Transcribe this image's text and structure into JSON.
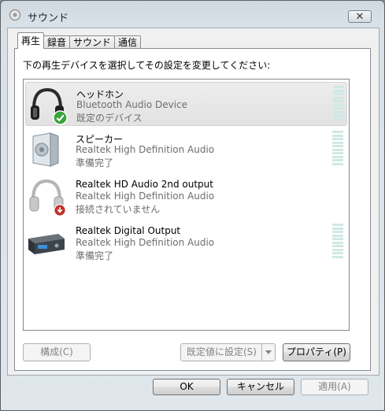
{
  "window": {
    "title": "サウンド",
    "close_symbol": "✕"
  },
  "tabs": [
    {
      "label": "再生",
      "active": true
    },
    {
      "label": "録音",
      "active": false
    },
    {
      "label": "サウンド",
      "active": false
    },
    {
      "label": "通信",
      "active": false
    }
  ],
  "instruction": "下の再生デバイスを選択してその設定を変更してください:",
  "devices": [
    {
      "name": "ヘッドホン",
      "description": "Bluetooth Audio Device",
      "status": "既定のデバイス",
      "icon": "headphones-icon",
      "badge": "default-check-icon",
      "selected": true
    },
    {
      "name": "スピーカー",
      "description": "Realtek High Definition Audio",
      "status": "準備完了",
      "icon": "speaker-icon",
      "selected": false
    },
    {
      "name": "Realtek HD Audio 2nd output",
      "description": "Realtek High Definition Audio",
      "status": "接続されていません",
      "icon": "headphones-icon",
      "badge": "disconnected-icon",
      "selected": false
    },
    {
      "name": "Realtek Digital Output",
      "description": "Realtek High Definition Audio",
      "status": "準備完了",
      "icon": "digital-output-icon",
      "selected": false
    }
  ],
  "buttons": {
    "configure": "構成(C)",
    "set_default": "既定値に設定(S)",
    "properties": "プロパティ(P)",
    "ok": "OK",
    "cancel": "キャンセル",
    "apply": "適用(A)"
  },
  "colors": {
    "meter": "#cfe9e4",
    "check_badge": "#3aa33a",
    "disconnected_badge": "#c0302a"
  }
}
